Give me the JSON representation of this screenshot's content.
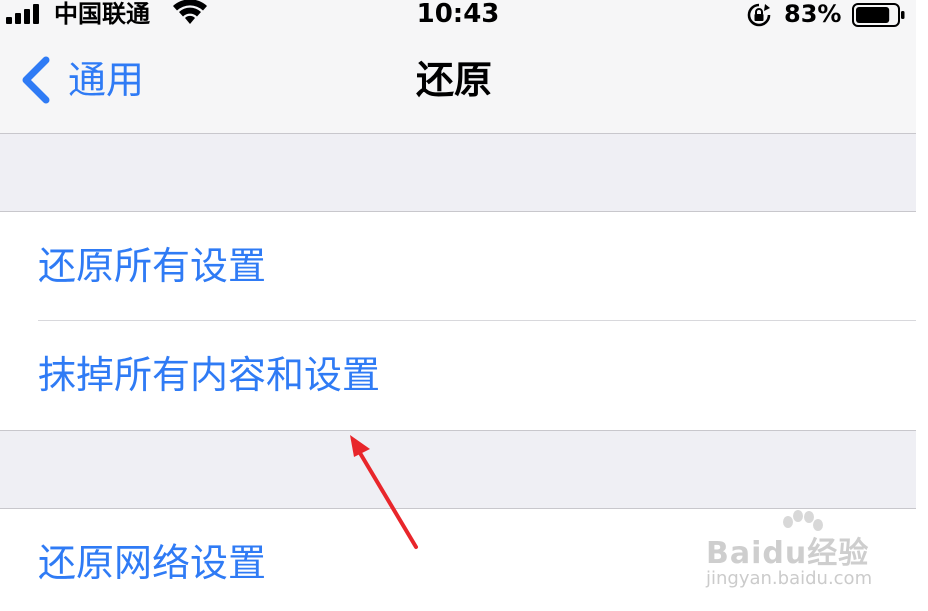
{
  "status_bar": {
    "carrier": "中国联通",
    "time": "10:43",
    "battery_percent": "83%",
    "battery_level": 0.83,
    "icons": [
      "signal-icon",
      "wifi-icon",
      "rotation-lock-icon",
      "battery-icon"
    ]
  },
  "nav": {
    "back_label": "通用",
    "title": "还原"
  },
  "groups": [
    {
      "items": [
        {
          "label": "还原所有设置"
        },
        {
          "label": "抹掉所有内容和设置"
        }
      ]
    },
    {
      "items": [
        {
          "label": "还原网络设置"
        }
      ]
    }
  ],
  "colors": {
    "accent": "#2f7bf5",
    "annotation_arrow": "#e8262b",
    "background_gray": "#efeff4"
  },
  "watermark": {
    "brand_text": "Baidu经验",
    "url": "jingyan.baidu.com"
  }
}
